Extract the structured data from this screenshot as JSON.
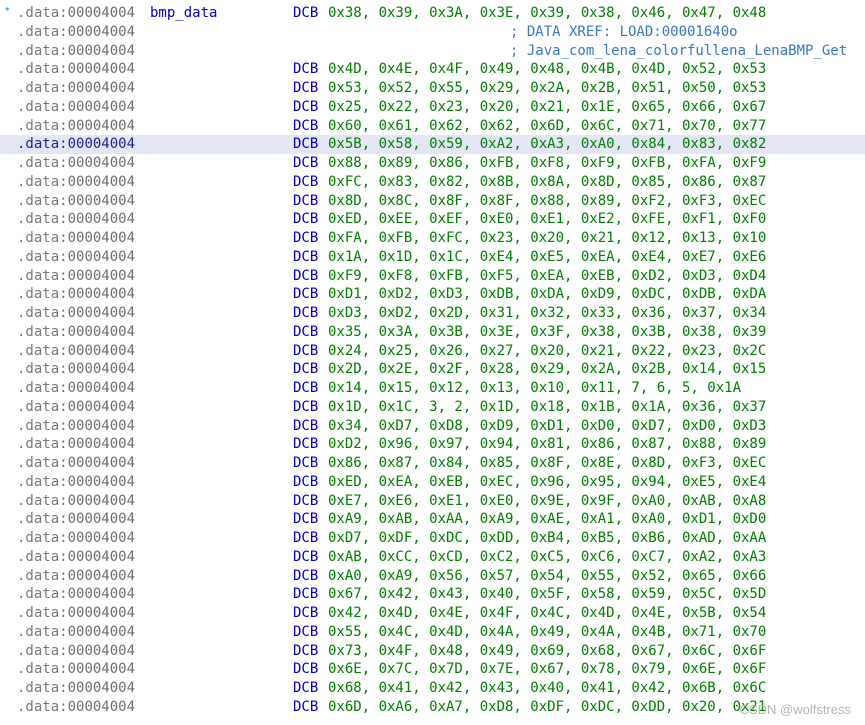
{
  "listing": {
    "segment": ".data",
    "address": "00004004",
    "label": "bmp_data",
    "mnemonic": "DCB",
    "selected_row": 7,
    "first_line_bullet": "•",
    "rows": [
      {
        "operands": "0x38, 0x39, 0x3A, 0x3E, 0x39, 0x38, 0x46, 0x47, 0x48",
        "label": "bmp_data"
      },
      {
        "comment": "; DATA XREF: LOAD:00001640o"
      },
      {
        "comment": "; Java_com_lena_colorfullena_LenaBMP_Get"
      },
      {
        "operands": "0x4D, 0x4E, 0x4F, 0x49, 0x48, 0x4B, 0x4D, 0x52, 0x53"
      },
      {
        "operands": "0x53, 0x52, 0x55, 0x29, 0x2A, 0x2B, 0x51, 0x50, 0x53"
      },
      {
        "operands": "0x25, 0x22, 0x23, 0x20, 0x21, 0x1E, 0x65, 0x66, 0x67"
      },
      {
        "operands": "0x60, 0x61, 0x62, 0x62, 0x6D, 0x6C, 0x71, 0x70, 0x77"
      },
      {
        "operands": "0x5B, 0x58, 0x59, 0xA2, 0xA3, 0xA0, 0x84, 0x83, 0x82"
      },
      {
        "operands": "0x88, 0x89, 0x86, 0xFB, 0xF8, 0xF9, 0xFB, 0xFA, 0xF9"
      },
      {
        "operands": "0xFC, 0x83, 0x82, 0x8B, 0x8A, 0x8D, 0x85, 0x86, 0x87"
      },
      {
        "operands": "0x8D, 0x8C, 0x8F, 0x8F, 0x88, 0x89, 0xF2, 0xF3, 0xEC"
      },
      {
        "operands": "0xED, 0xEE, 0xEF, 0xE0, 0xE1, 0xE2, 0xFE, 0xF1, 0xF0"
      },
      {
        "operands": "0xFA, 0xFB, 0xFC, 0x23, 0x20, 0x21, 0x12, 0x13, 0x10"
      },
      {
        "operands": "0x1A, 0x1D, 0x1C, 0xE4, 0xE5, 0xEA, 0xE4, 0xE7, 0xE6"
      },
      {
        "operands": "0xF9, 0xF8, 0xFB, 0xF5, 0xEA, 0xEB, 0xD2, 0xD3, 0xD4"
      },
      {
        "operands": "0xD1, 0xD2, 0xD3, 0xDB, 0xDA, 0xD9, 0xDC, 0xDB, 0xDA"
      },
      {
        "operands": "0xD3, 0xD2, 0x2D, 0x31, 0x32, 0x33, 0x36, 0x37, 0x34"
      },
      {
        "operands": "0x35, 0x3A, 0x3B, 0x3E, 0x3F, 0x38, 0x3B, 0x38, 0x39"
      },
      {
        "operands": "0x24, 0x25, 0x26, 0x27, 0x20, 0x21, 0x22, 0x23, 0x2C"
      },
      {
        "operands": "0x2D, 0x2E, 0x2F, 0x28, 0x29, 0x2A, 0x2B, 0x14, 0x15"
      },
      {
        "operands": "0x14, 0x15, 0x12, 0x13, 0x10, 0x11, 7, 6, 5, 0x1A"
      },
      {
        "operands": "0x1D, 0x1C, 3, 2, 0x1D, 0x18, 0x1B, 0x1A, 0x36, 0x37"
      },
      {
        "operands": "0x34, 0xD7, 0xD8, 0xD9, 0xD1, 0xD0, 0xD7, 0xD0, 0xD3"
      },
      {
        "operands": "0xD2, 0x96, 0x97, 0x94, 0x81, 0x86, 0x87, 0x88, 0x89"
      },
      {
        "operands": "0x86, 0x87, 0x84, 0x85, 0x8F, 0x8E, 0x8D, 0xF3, 0xEC"
      },
      {
        "operands": "0xED, 0xEA, 0xEB, 0xEC, 0x96, 0x95, 0x94, 0xE5, 0xE4"
      },
      {
        "operands": "0xE7, 0xE6, 0xE1, 0xE0, 0x9E, 0x9F, 0xA0, 0xAB, 0xA8"
      },
      {
        "operands": "0xA9, 0xAB, 0xAA, 0xA9, 0xAE, 0xA1, 0xA0, 0xD1, 0xD0"
      },
      {
        "operands": "0xD7, 0xDF, 0xDC, 0xDD, 0xB4, 0xB5, 0xB6, 0xAD, 0xAA"
      },
      {
        "operands": "0xAB, 0xCC, 0xCD, 0xC2, 0xC5, 0xC6, 0xC7, 0xA2, 0xA3"
      },
      {
        "operands": "0xA0, 0xA9, 0x56, 0x57, 0x54, 0x55, 0x52, 0x65, 0x66"
      },
      {
        "operands": "0x67, 0x42, 0x43, 0x40, 0x5F, 0x58, 0x59, 0x5C, 0x5D"
      },
      {
        "operands": "0x42, 0x4D, 0x4E, 0x4F, 0x4C, 0x4D, 0x4E, 0x5B, 0x54"
      },
      {
        "operands": "0x55, 0x4C, 0x4D, 0x4A, 0x49, 0x4A, 0x4B, 0x71, 0x70"
      },
      {
        "operands": "0x73, 0x4F, 0x48, 0x49, 0x69, 0x68, 0x67, 0x6C, 0x6F"
      },
      {
        "operands": "0x6E, 0x7C, 0x7D, 0x7E, 0x67, 0x78, 0x79, 0x6E, 0x6F"
      },
      {
        "operands": "0x68, 0x41, 0x42, 0x43, 0x40, 0x41, 0x42, 0x6B, 0x6C"
      },
      {
        "operands": "0x6D, 0xA6, 0xA7, 0xD8, 0xDF, 0xDC, 0xDD, 0x20, 0x21"
      }
    ]
  },
  "watermark": "CSDN @wolfstress",
  "colors": {
    "address": "#6e6e6e",
    "label": "#0000c8",
    "mnemonic": "#0000c8",
    "operand": "#008000",
    "comment": "#3a78c4",
    "selected_background": "#e4e6f5",
    "bullet": "#36b3e6"
  }
}
